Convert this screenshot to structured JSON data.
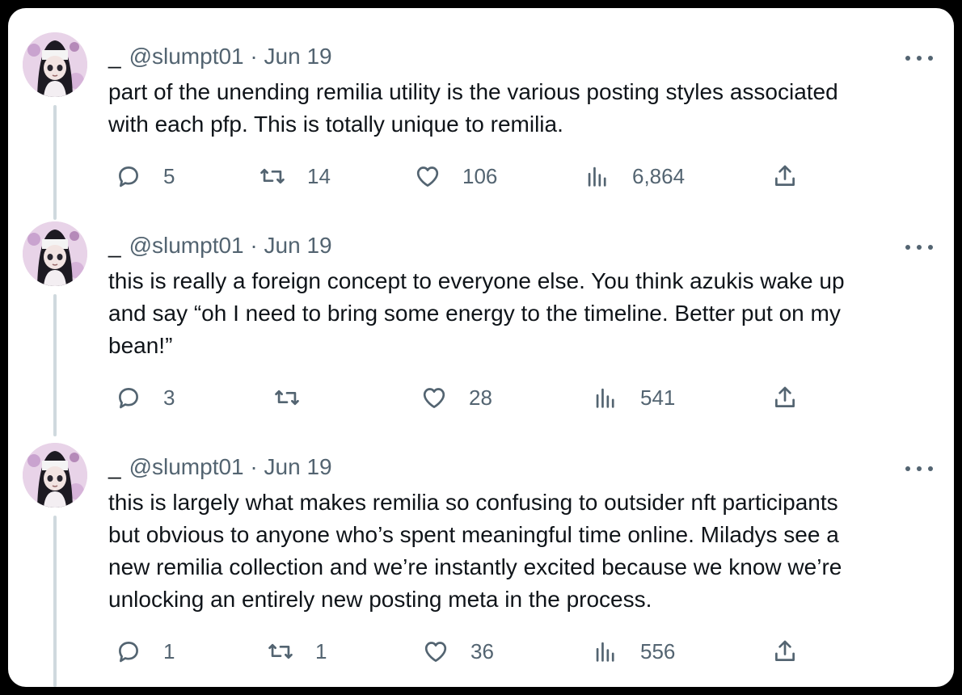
{
  "colors": {
    "text": "#0f1419",
    "secondary": "#536471",
    "thread_line": "#cfd9de",
    "background": "#ffffff"
  },
  "icons": {
    "reply": "reply-bubble-icon",
    "retweet": "retweet-arrows-icon",
    "like": "heart-icon",
    "views": "bar-chart-icon",
    "share": "share-upload-icon",
    "more": "more-dots-icon"
  },
  "tweets": [
    {
      "display_name": "_",
      "handle": "@slumpt01",
      "separator": "·",
      "date": "Jun 19",
      "text": "part of the unending remilia utility is the various posting styles associated\nwith each pfp. This is totally unique to remilia.",
      "replies": "5",
      "retweets": "14",
      "likes": "106",
      "views": "6,864"
    },
    {
      "display_name": "_",
      "handle": "@slumpt01",
      "separator": "·",
      "date": "Jun 19",
      "text": "this is really a foreign concept to everyone else. You think azukis wake up\nand say “oh I need to bring some energy to the timeline. Better put on my\nbean!”",
      "replies": "3",
      "retweets": "",
      "likes": "28",
      "views": "541"
    },
    {
      "display_name": "_",
      "handle": "@slumpt01",
      "separator": "·",
      "date": "Jun 19",
      "text": "this is largely what makes remilia so confusing to outsider nft participants\nbut obvious to anyone who’s spent meaningful time online. Miladys see a\nnew remilia collection and we’re instantly excited because we know we’re\nunlocking an entirely new posting meta in the process.",
      "replies": "1",
      "retweets": "1",
      "likes": "36",
      "views": "556"
    }
  ]
}
